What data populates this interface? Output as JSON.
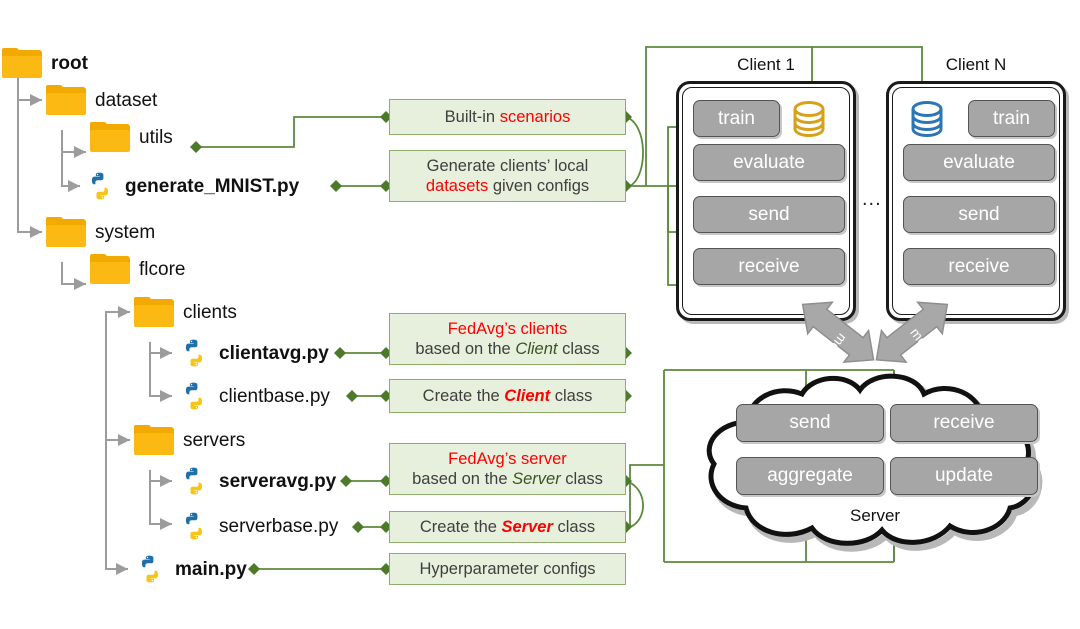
{
  "tree": {
    "root_label": "root",
    "nodes": [
      {
        "id": "root",
        "label": "root",
        "type": "folder",
        "bold": true
      },
      {
        "id": "dataset",
        "label": "dataset",
        "type": "folder",
        "bold": false
      },
      {
        "id": "utils",
        "label": "utils",
        "type": "folder",
        "bold": false
      },
      {
        "id": "generate_mnist",
        "label": "generate_MNIST.py",
        "type": "python",
        "bold": true
      },
      {
        "id": "system",
        "label": "system",
        "type": "folder",
        "bold": false
      },
      {
        "id": "flcore",
        "label": "flcore",
        "type": "folder",
        "bold": false
      },
      {
        "id": "clients",
        "label": "clients",
        "type": "folder",
        "bold": false
      },
      {
        "id": "clientavg",
        "label": "clientavg.py",
        "type": "python",
        "bold": true
      },
      {
        "id": "clientbase",
        "label": "clientbase.py",
        "type": "python",
        "bold": false
      },
      {
        "id": "servers",
        "label": "servers",
        "type": "folder",
        "bold": false
      },
      {
        "id": "serveravg",
        "label": "serveravg.py",
        "type": "python",
        "bold": true
      },
      {
        "id": "serverbase",
        "label": "serverbase.py",
        "type": "python",
        "bold": false
      },
      {
        "id": "main",
        "label": "main.py",
        "type": "python",
        "bold": true
      }
    ]
  },
  "descriptions": [
    {
      "id": "builtin",
      "text_plain": "Built-in scenarios",
      "parts": [
        {
          "t": "Built-in ",
          "s": "dark"
        },
        {
          "t": "scenarios",
          "s": "red"
        }
      ]
    },
    {
      "id": "generate",
      "text_plain": "Generate clients’ local datasets given configs",
      "parts": [
        {
          "t": "Generate clients’ local",
          "s": "dark"
        },
        {
          "t": "\n",
          "s": "br"
        },
        {
          "t": "datasets",
          "s": "red"
        },
        {
          "t": " given configs",
          "s": "dark"
        }
      ]
    },
    {
      "id": "fedavg_clients",
      "text_plain": "FedAvg’s clients based on the Client class",
      "parts": [
        {
          "t": "FedAvg’s clients",
          "s": "red"
        },
        {
          "t": "\n",
          "s": "br"
        },
        {
          "t": "based on the ",
          "s": "dark"
        },
        {
          "t": "Client",
          "s": "ital"
        },
        {
          "t": " class",
          "s": "dark"
        }
      ]
    },
    {
      "id": "create_client",
      "text_plain": "Create the Client class",
      "parts": [
        {
          "t": "Create the ",
          "s": "dark"
        },
        {
          "t": "Client",
          "s": "redital"
        },
        {
          "t": " class",
          "s": "dark"
        }
      ]
    },
    {
      "id": "fedavg_server",
      "text_plain": "FedAvg’s server based on the Server class",
      "parts": [
        {
          "t": "FedAvg’s server",
          "s": "red"
        },
        {
          "t": "\n",
          "s": "br"
        },
        {
          "t": "based on the ",
          "s": "dark"
        },
        {
          "t": "Server",
          "s": "ital"
        },
        {
          "t": " class",
          "s": "dark"
        }
      ]
    },
    {
      "id": "create_server",
      "text_plain": "Create the Server class",
      "parts": [
        {
          "t": "Create the ",
          "s": "dark"
        },
        {
          "t": "Server",
          "s": "redital"
        },
        {
          "t": " class",
          "s": "dark"
        }
      ]
    },
    {
      "id": "hyperparam",
      "text_plain": "Hyperparameter configs",
      "parts": [
        {
          "t": "Hyperparameter configs",
          "s": "dark"
        }
      ]
    }
  ],
  "clients": [
    {
      "id": "client1",
      "title": "Client 1",
      "buttons": [
        "train",
        "evaluate",
        "send",
        "receive"
      ],
      "db_color": "#d9a11a",
      "db_side": "right"
    },
    {
      "id": "clientN",
      "title": "Client N",
      "buttons": [
        "train",
        "evaluate",
        "send",
        "receive"
      ],
      "db_color": "#2e75b6",
      "db_side": "left"
    }
  ],
  "clients_ellipsis": "...",
  "server": {
    "label": "Server",
    "buttons": [
      "send",
      "receive",
      "aggregate",
      "update"
    ]
  },
  "model_arrows": [
    {
      "id": "model-arrow-left",
      "label": "model"
    },
    {
      "id": "model-arrow-right",
      "label": "model"
    }
  ],
  "colors": {
    "folder": "#fdb913",
    "green_fill": "#e6f0dc",
    "green_stroke": "#8fad6b",
    "green_line": "#5c8a3a",
    "gray_button": "#a6a6a6",
    "red_text": "#ff0000",
    "dark_text": "#3f3f3f",
    "db_gold": "#d9a11a",
    "db_blue": "#2e75b6"
  }
}
